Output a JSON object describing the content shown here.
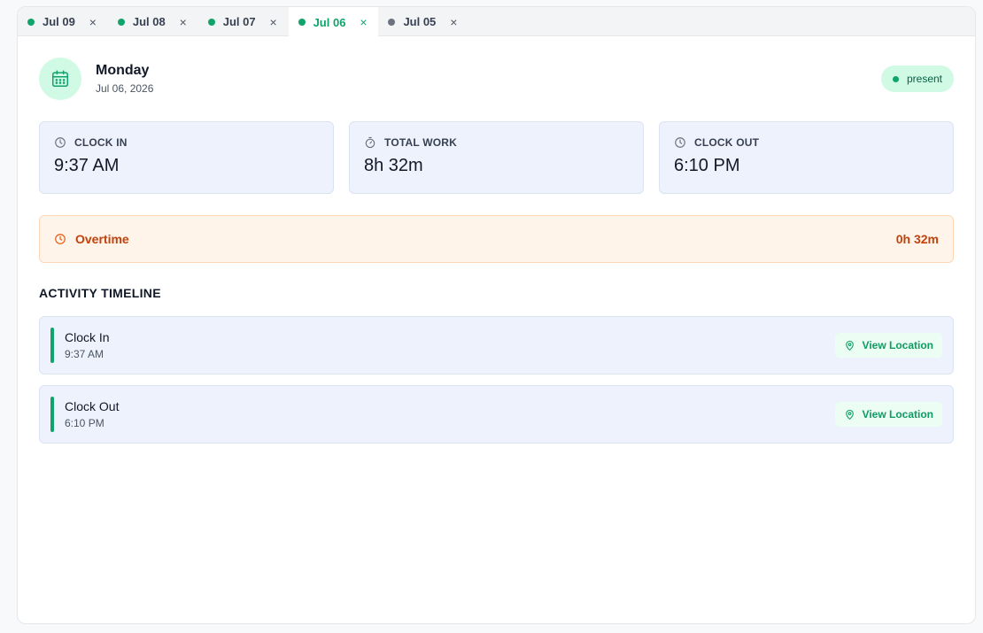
{
  "tabs": [
    {
      "label": "Jul 09",
      "status": "present",
      "active": false
    },
    {
      "label": "Jul 08",
      "status": "present",
      "active": false
    },
    {
      "label": "Jul 07",
      "status": "present",
      "active": false
    },
    {
      "label": "Jul 06",
      "status": "present",
      "active": true
    },
    {
      "label": "Jul 05",
      "status": "none",
      "active": false
    }
  ],
  "tab_close_glyph": "×",
  "day": {
    "weekday": "Monday",
    "date": "Jul 06, 2026",
    "status": "present",
    "icon": "calendar-icon"
  },
  "stats": {
    "clock_in": {
      "label": "CLOCK IN",
      "value": "9:37 AM",
      "icon": "clock-icon"
    },
    "total_work": {
      "label": "TOTAL WORK",
      "value": "8h 32m",
      "icon": "stopwatch-icon"
    },
    "clock_out": {
      "label": "CLOCK OUT",
      "value": "6:10 PM",
      "icon": "clock-icon"
    }
  },
  "overtime": {
    "label": "Overtime",
    "value": "0h 32m",
    "icon": "clock-icon"
  },
  "timeline": {
    "title": "ACTIVITY TIMELINE",
    "items": [
      {
        "title": "Clock In",
        "time": "9:37 AM",
        "action": "View Location"
      },
      {
        "title": "Clock Out",
        "time": "6:10 PM",
        "action": "View Location"
      }
    ]
  },
  "colors": {
    "accent": "#10a46a",
    "overtime": "#c2410c",
    "card_bg": "#eef2fd"
  }
}
